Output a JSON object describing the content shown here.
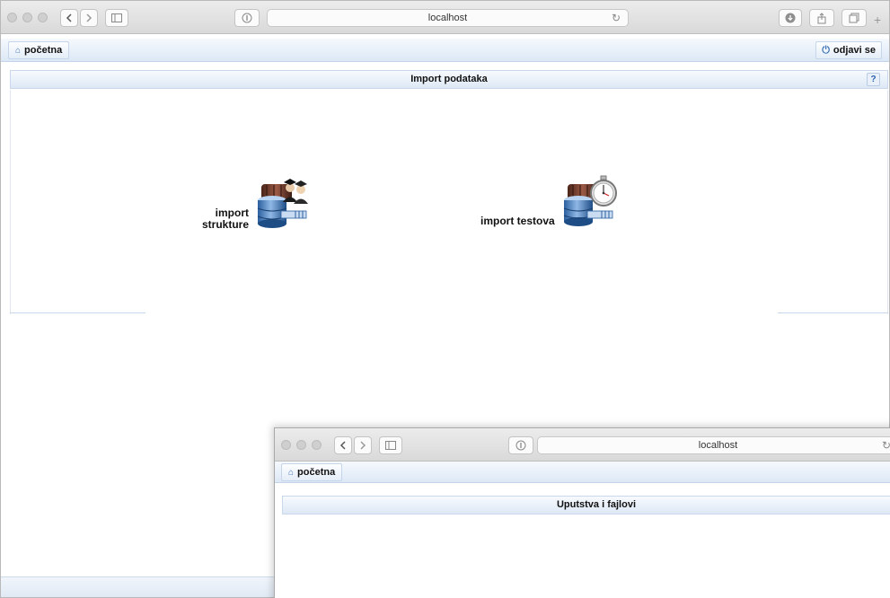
{
  "browser": {
    "url": "localhost"
  },
  "navbar": {
    "home_label": "početna",
    "logout_label": "odjavi se"
  },
  "panel": {
    "title": "Import podataka",
    "help_label": "?"
  },
  "imports": [
    {
      "label_line1": "import",
      "label_line2": "strukture",
      "icon": "database-users-icon"
    },
    {
      "label_line1": "import testova",
      "icon": "database-stopwatch-icon"
    }
  ],
  "second_window": {
    "url": "localhost",
    "home_label": "početna",
    "panel_title": "Uputstva i fajlovi"
  }
}
